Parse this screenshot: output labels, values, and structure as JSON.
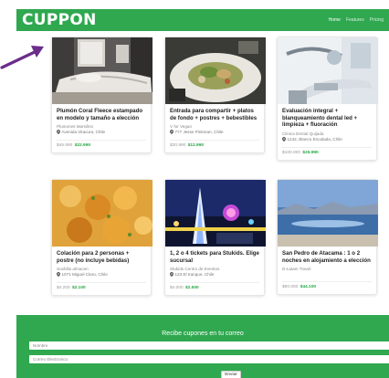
{
  "brand": "CUPPON",
  "nav": [
    "Home",
    "Features",
    "Pricing"
  ],
  "deals": [
    {
      "title": "Plumón Coral Fleece estampado en modelo y tamaño a elección",
      "merchant": "Plumones Marsilino",
      "location": "Avenida Vitacura, Chile",
      "old_price": "$45.990",
      "new_price": "$22.990"
    },
    {
      "title": "Entrada para compartir + platos de fondo + postres + bebestibles",
      "merchant": "V for Vegan",
      "location": "777 Jesse Pinkman, Chile",
      "old_price": "$30.990",
      "new_price": "$12.990"
    },
    {
      "title": "Evaluación integral + blanqueamiento dental led + limpieza + fluoración",
      "merchant": "Clinica Dental Quijada",
      "location": "1242, Blanco Encalada, Chile",
      "old_price": "$100.000",
      "new_price": "$25.990"
    },
    {
      "title": "Colación para 2 personas + postre (no incluye bebidas)",
      "merchant": "Sushilla almacen",
      "location": "1071 Miguel Claro, Chile",
      "old_price": "$4.200",
      "new_price": "$2.100"
    },
    {
      "title": "1, 2 o 4 tickets para Stukids. Elige sucursal",
      "merchant": "Stukids Centro de Eventos",
      "location": "133 El tranque, Chile",
      "old_price": "$4.000",
      "new_price": "$2.500"
    },
    {
      "title": "San Pedro de Atacama : 1 o 2 noches en alojamiento a elección",
      "merchant": "D-Latam Travel",
      "location": "",
      "old_price": "$90.000",
      "new_price": "$44.100"
    }
  ],
  "newsletter": {
    "title": "Recibe cupones en tu correo",
    "name_placeholder": "Nombre",
    "email_placeholder": "Correo Electronico",
    "submit": "Enviar"
  },
  "colors": {
    "brand_green": "#2fa84f",
    "price_green": "#28a745",
    "arrow": "#6b2d8a"
  }
}
